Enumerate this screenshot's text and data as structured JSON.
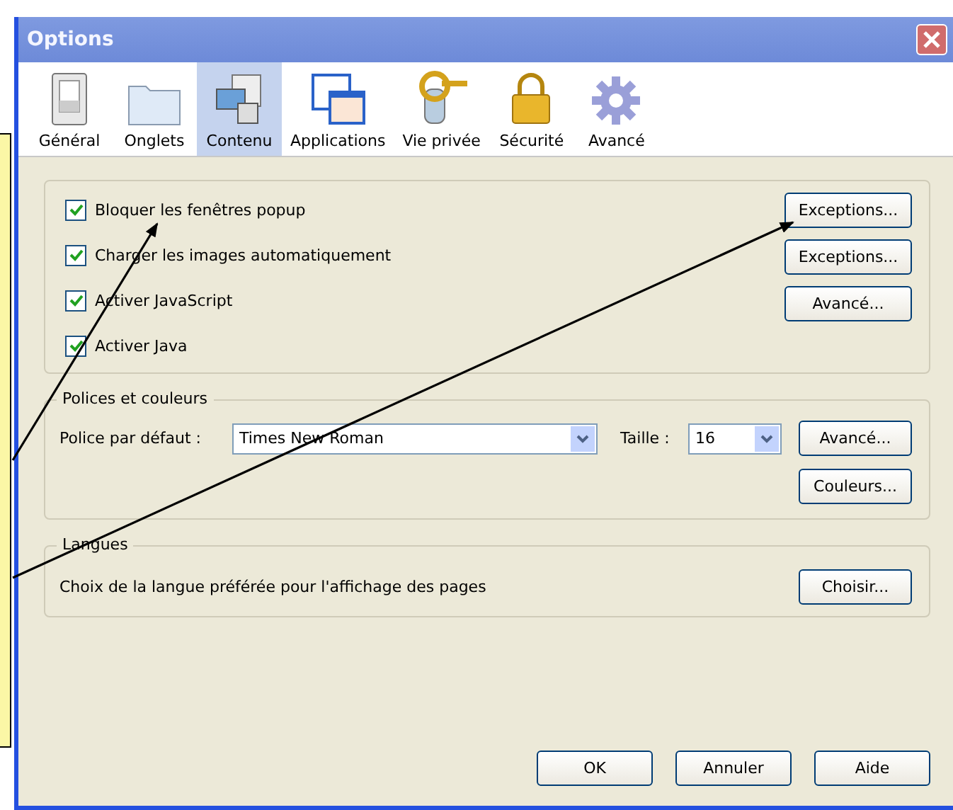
{
  "window": {
    "title": "Options"
  },
  "tabs": [
    {
      "label": "Général",
      "selected": false,
      "kind": "general"
    },
    {
      "label": "Onglets",
      "selected": false,
      "kind": "tabs"
    },
    {
      "label": "Contenu",
      "selected": true,
      "kind": "content"
    },
    {
      "label": "Applications",
      "selected": false,
      "kind": "applications"
    },
    {
      "label": "Vie privée",
      "selected": false,
      "kind": "privacy"
    },
    {
      "label": "Sécurité",
      "selected": false,
      "kind": "security"
    },
    {
      "label": "Avancé",
      "selected": false,
      "kind": "advanced"
    }
  ],
  "content_group": {
    "checkboxes": [
      {
        "label": "Bloquer les fenêtres popup",
        "checked": true
      },
      {
        "label": "Charger les images automatiquement",
        "checked": true
      },
      {
        "label": "Activer JavaScript",
        "checked": true
      },
      {
        "label": "Activer Java",
        "checked": true
      }
    ],
    "buttons": [
      "Exceptions...",
      "Exceptions...",
      "Avancé..."
    ]
  },
  "fonts_group": {
    "legend": "Polices et couleurs",
    "font_label": "Police par défaut :",
    "font_value": "Times New Roman",
    "size_label": "Taille :",
    "size_value": "16",
    "buttons": [
      "Avancé...",
      "Couleurs..."
    ]
  },
  "languages_group": {
    "legend": "Langues",
    "text": "Choix de la langue préférée pour l'affichage des pages",
    "button": "Choisir..."
  },
  "footer_buttons": [
    "OK",
    "Annuler",
    "Aide"
  ]
}
